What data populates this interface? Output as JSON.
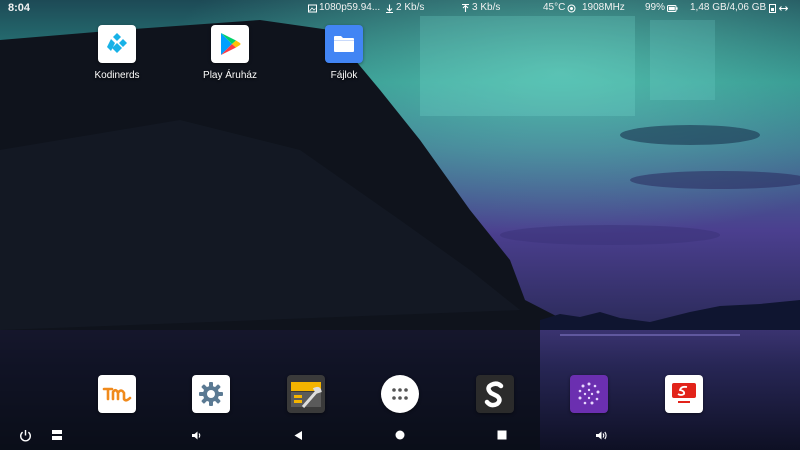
{
  "status_bar": {
    "time": "8:04",
    "video_mode": "1080p59.94...",
    "download_speed": "2 Kb/s",
    "upload_speed": "3 Kb/s",
    "temperature": "45°C",
    "cpu_frequency": "1908MHz",
    "battery": "99%",
    "memory": "1,48 GB/4,06 GB",
    "icons": [
      "image-icon",
      "download-arrow-icon",
      "upload-arrow-icon",
      "thermometer-icon",
      "cpu-icon",
      "battery-icon",
      "memory-icon",
      "expand-arrows-icon"
    ]
  },
  "desktop_apps": [
    {
      "label": "Kodinerds",
      "icon": "kodi-icon"
    },
    {
      "label": "Play Áruház",
      "icon": "play-store-icon"
    },
    {
      "label": "Fájlok",
      "icon": "files-folder-icon"
    }
  ],
  "dock": [
    {
      "icon": "tm-app-icon"
    },
    {
      "icon": "settings-gear-icon"
    },
    {
      "icon": "toolbox-icon"
    },
    {
      "icon": "app-drawer-icon"
    },
    {
      "icon": "s-app-icon"
    },
    {
      "icon": "purple-sparkle-app-icon"
    },
    {
      "icon": "red-app-icon"
    }
  ],
  "nav_bar": {
    "icons": [
      "power-icon",
      "split-screen-icon",
      "volume-down-icon",
      "back-icon",
      "home-icon",
      "recents-icon",
      "volume-up-icon"
    ]
  },
  "colors": {
    "aurora_teal": "#3fb3a6",
    "sky_purple": "#4a3f8f",
    "files_blue": "#4285f4"
  }
}
